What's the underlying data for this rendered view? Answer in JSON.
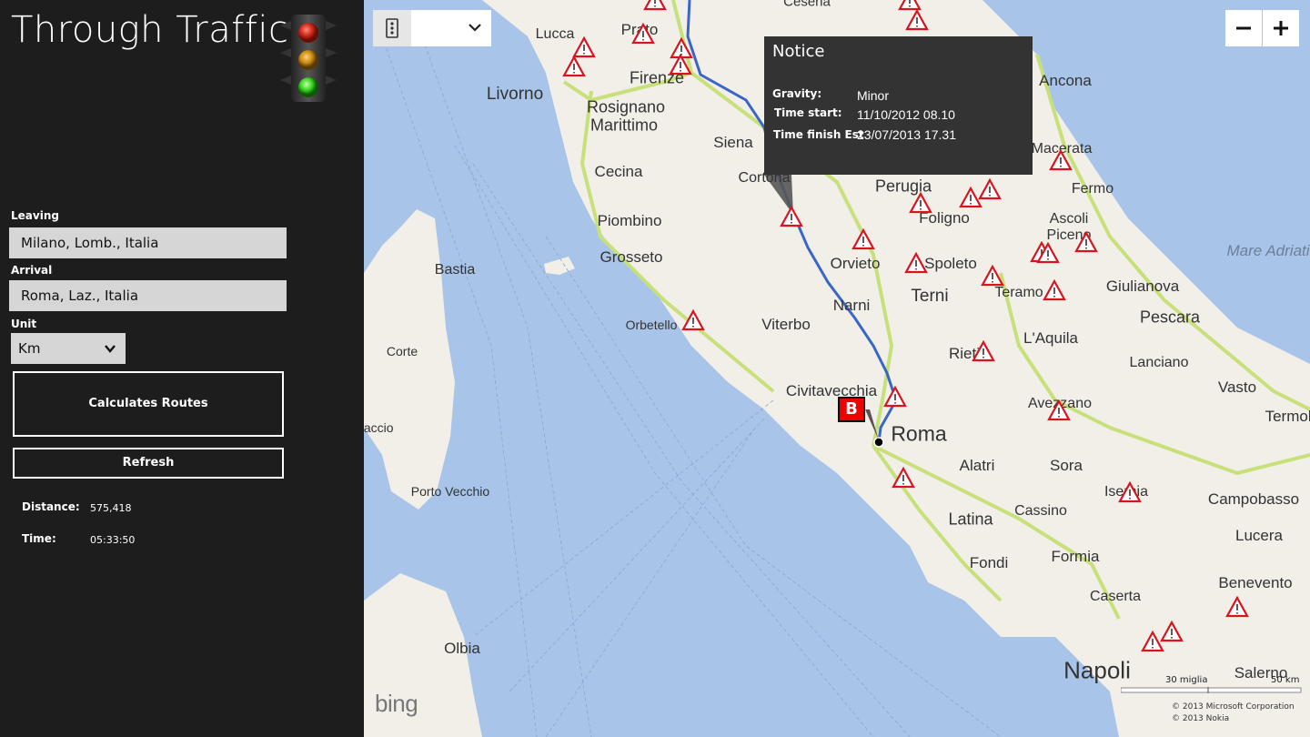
{
  "app": {
    "title": "Through Traffic"
  },
  "form": {
    "leaving_label": "Leaving",
    "leaving_value": "Milano, Lomb., Italia",
    "arrival_label": "Arrival",
    "arrival_value": "Roma, Laz., Italia",
    "unit_label": "Unit",
    "unit_value": "Km",
    "calculate_label": "Calculates Routes",
    "refresh_label": "Refresh"
  },
  "results": {
    "distance_label": "Distance:",
    "distance_value": "575,418",
    "time_label": "Time:",
    "time_value": "05:33:50"
  },
  "map": {
    "notice": {
      "title": "Notice",
      "gravity_label": "Gravity:",
      "gravity_value": "Minor",
      "start_label": "Time start:",
      "start_value": "11/10/2012 08.10",
      "finish_label": "Time finish Est",
      "finish_value": "23/07/2013 17.31"
    },
    "pin_label": "B",
    "zoom_out_icon": "minus-icon",
    "zoom_in_icon": "plus-icon",
    "layer_icon": "layers-icon",
    "scale_miles": "30 miglia",
    "scale_km": "50 km",
    "copyright_1": "© 2013 Microsoft Corporation",
    "copyright_2": "© 2013 Nokia",
    "logo": "bing",
    "cities": [
      {
        "name": "Through Traffic"
      },
      {
        "name": "Lucca"
      },
      {
        "name": "Prato"
      },
      {
        "name": "Firenze"
      },
      {
        "name": "Livorno"
      },
      {
        "name": "Rosignano"
      },
      {
        "name": "Marittimo"
      },
      {
        "name": "Siena"
      },
      {
        "name": "Cecina"
      },
      {
        "name": "Cortona"
      },
      {
        "name": "Piombino"
      },
      {
        "name": "Grosseto"
      },
      {
        "name": "Bastia"
      },
      {
        "name": "Orbetello"
      },
      {
        "name": "Corte"
      },
      {
        "name": "Porto Vecchio"
      },
      {
        "name": "Olbia"
      },
      {
        "name": "Perugia"
      },
      {
        "name": "Foligno"
      },
      {
        "name": "Orvieto"
      },
      {
        "name": "Spoleto"
      },
      {
        "name": "Terni"
      },
      {
        "name": "Narni"
      },
      {
        "name": "Viterbo"
      },
      {
        "name": "Civitavecchia"
      },
      {
        "name": "Roma"
      },
      {
        "name": "Rieti"
      },
      {
        "name": "L'Aquila"
      },
      {
        "name": "Teramo"
      },
      {
        "name": "Ancona"
      },
      {
        "name": "Macerata"
      },
      {
        "name": "Fermo"
      },
      {
        "name": "Ascoli"
      },
      {
        "name": "Piceno"
      },
      {
        "name": "Giulianova"
      },
      {
        "name": "Pescara"
      },
      {
        "name": "Lanciano"
      },
      {
        "name": "Vasto"
      },
      {
        "name": "Termoli"
      },
      {
        "name": "Avezzano"
      },
      {
        "name": "Alatri"
      },
      {
        "name": "Sora"
      },
      {
        "name": "Isernia"
      },
      {
        "name": "Campobasso"
      },
      {
        "name": "Lucera"
      },
      {
        "name": "Cassino"
      },
      {
        "name": "Latina"
      },
      {
        "name": "Fondi"
      },
      {
        "name": "Formia"
      },
      {
        "name": "Caserta"
      },
      {
        "name": "Benevento"
      },
      {
        "name": "Napoli"
      },
      {
        "name": "Salerno"
      },
      {
        "name": "Mare Adriatico"
      },
      {
        "name": "Cesena"
      },
      {
        "name": "Benevento"
      },
      {
        "name": "Ajaccio"
      }
    ]
  },
  "colors": {
    "sidebar": "#1d1d1d",
    "sea": "#a8c4e8",
    "land": "#f2efe9",
    "route": "#3a66c8",
    "notice": "#333333",
    "pin": "#e00000"
  }
}
